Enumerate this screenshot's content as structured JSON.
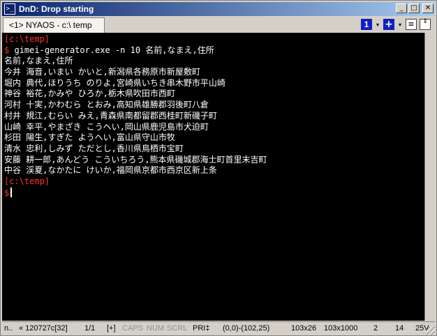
{
  "window": {
    "title": "DnD: Drop starting",
    "icon": "terminal-icon",
    "buttons": [
      "minimize-icon",
      "maximize-icon",
      "close-icon"
    ]
  },
  "tabs": [
    {
      "label": "<1> NYAOS - c:\\ temp",
      "active": true
    }
  ],
  "toolbar": {
    "tab_number": "1",
    "arrow": "▾",
    "plus": "+",
    "menu": "≡",
    "scroll": "⇕"
  },
  "console": {
    "prompt_path": "[c:\\temp]",
    "prompt_sign": "$",
    "command": "gimei-generator.exe -n 10 名前,なまえ,住所",
    "output": [
      "名前,なまえ,住所",
      "今井 海音,いまい かいと,新潟県各務原市新屋敷町",
      "堀内 典代,ほりうち のりよ,宮崎県いちき串木野市平山崎",
      "神谷 裕花,かみや ひろか,栃木県吹田市西町",
      "河村 十実,かわむら とおみ,高知県雄勝郡羽後町八倉",
      "村井 規江,むらい みえ,青森県南都留郡西桂町新磯子町",
      "山崎 幸平,やまざき こうへい,岡山県鹿児島市犬迫町",
      "杉田 陽生,すぎた ようへい,富山県守山市牧",
      "清水 忠利,しみず ただとし,香川県鳥栖市宝町",
      "安藤 耕一郎,あんどう こういちろう,熊本県磯城郡海士町首里末吉町",
      "中谷 渓夏,なかたに けいか,福岡県京都市西京区新上条"
    ],
    "prompt_path_2": "[c:\\temp]",
    "prompt_sign_2": "$"
  },
  "status": {
    "mode": "n..",
    "codepoint": "« 120727c[32]",
    "page": "1/1",
    "plus": "[+]",
    "caps": "CAPS",
    "num": "NUM",
    "scrl": "SCRL",
    "pri": "PRI‡",
    "range": "(0,0)-(102,25)",
    "size1": "103x26",
    "size2": "103x1000",
    "n1": "2",
    "n2": "14",
    "volt": "25V"
  },
  "colors": {
    "prompt": "#ff3030",
    "console_bg": "#000000",
    "title_bar": "#0a246a"
  }
}
